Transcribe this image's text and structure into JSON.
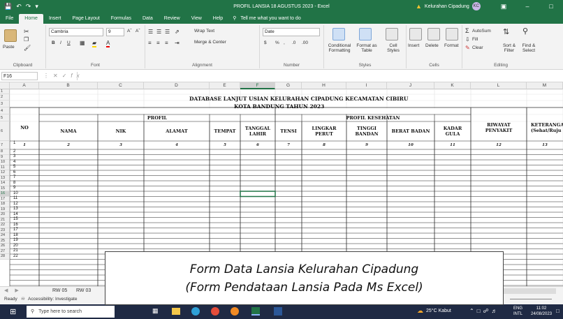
{
  "window": {
    "doc_title": "PROFIL LANSIA 18 AGUSTUS 2023 - Excel",
    "user_name": "Kelurahan Cipadung",
    "user_initials": "KC"
  },
  "menu": {
    "tabs": [
      "File",
      "Home",
      "Insert",
      "Page Layout",
      "Formulas",
      "Data",
      "Review",
      "View",
      "Help"
    ],
    "active_tab": "Home",
    "tell_me": "Tell me what you want to do"
  },
  "ribbon": {
    "paste": "Paste",
    "clipboard": "Clipboard",
    "font_name": "Cambria",
    "font_size": "9",
    "font_group": "Font",
    "wrap_text": "Wrap Text",
    "merge_center": "Merge & Center",
    "alignment_group": "Alignment",
    "number_format": "Date",
    "number_group": "Number",
    "conditional_formatting": "Conditional Formatting",
    "format_as_table": "Format as Table",
    "cell_styles": "Cell Styles",
    "styles_group": "Styles",
    "insert": "Insert",
    "delete": "Delete",
    "format": "Format",
    "cells_group": "Cells",
    "autosum": "AutoSum",
    "fill": "Fill",
    "clear": "Clear",
    "sort_filter": "Sort & Filter",
    "find_select": "Find & Select",
    "editing_group": "Editing"
  },
  "formula_bar": {
    "name_box": "F16",
    "fx": "fx",
    "content": ""
  },
  "columns": [
    "A",
    "B",
    "C",
    "D",
    "E",
    "F",
    "G",
    "H",
    "I",
    "J",
    "K",
    "L",
    "M"
  ],
  "selected_column": "F",
  "rows": [
    "1",
    "2",
    "3",
    "4",
    "5",
    "6",
    "7",
    "8",
    "9",
    "10",
    "11",
    "12",
    "13",
    "14",
    "15",
    "16",
    "17",
    "18",
    "19",
    "20",
    "21",
    "22",
    "23",
    "24",
    "25",
    "26",
    "27",
    "28"
  ],
  "selected_row": "16",
  "sheet": {
    "title_line1": "DATABASE LANJUT USIAN KELURAHAN CIPADUNG KECAMATAN CIBIRU",
    "title_line2": "KOTA BANDUNG TAHUN 2023",
    "header_no": "NO",
    "group_profil": "PROFIL",
    "group_kesehatan": "PROFIL KESEHATAN",
    "headers": {
      "nama": "NAMA",
      "nik": "NIK",
      "alamat": "ALAMAT",
      "tempat": "TEMPAT",
      "tanggal_lahir": "TANGGAL LAHIR",
      "tensi": "TENSI",
      "lingkar_perut": "LINGKAR PERUT",
      "tinggi_badan": "TINGGI BANDAN",
      "berat_badan": "BERAT BADAN",
      "kadar_gula": "KADAR GULA",
      "riwayat_penyakit": "RIWAYAT PENYAKIT",
      "keterangan": "KETERANGA (Sehat/Ruju"
    },
    "col_numbers": [
      "1",
      "2",
      "3",
      "4",
      "5",
      "6",
      "7",
      "8",
      "9",
      "10",
      "11",
      "12",
      "13"
    ],
    "row_numbers": [
      "1",
      "2",
      "3",
      "4",
      "5",
      "6",
      "7",
      "8",
      "9",
      "10",
      "11",
      "12",
      "13",
      "14",
      "15",
      "16",
      "17",
      "18",
      "19",
      "20",
      "21",
      "22"
    ]
  },
  "sheet_tabs": [
    "RW 05",
    "RW 03"
  ],
  "status": {
    "ready": "Ready",
    "accessibility": "Accessibility: Investigate"
  },
  "taskbar": {
    "search_placeholder": "Type here to search",
    "weather": "25°C  Kabut",
    "lang": "ENG",
    "lang2": "INTL",
    "time": "11:02",
    "date": "24/08/2023"
  },
  "overlay": {
    "line1": "Form Data Lansia Kelurahan Cipadung",
    "line2": "(Form Pendataan Lansia Pada Ms Excel)"
  },
  "colors": {
    "excel_green": "#217346",
    "taskbar": "#1f2a44"
  }
}
